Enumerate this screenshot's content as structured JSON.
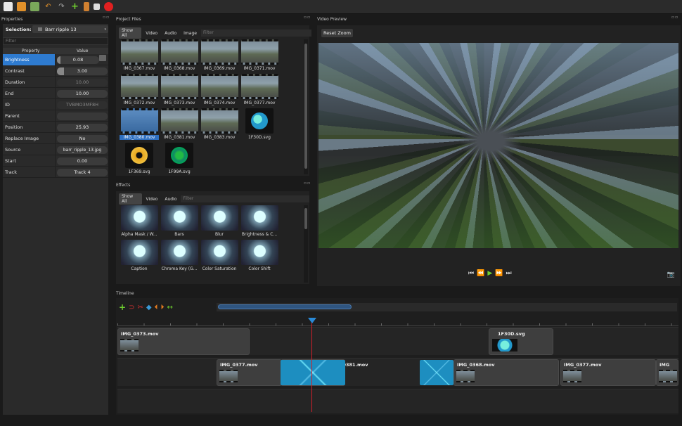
{
  "toolbar": {
    "buttons": [
      "new-project",
      "open-project",
      "save-project",
      "undo",
      "redo",
      "import-files",
      "choose-profile",
      "fullscreen",
      "export"
    ]
  },
  "properties": {
    "title": "Properties",
    "selection_label": "Selection:",
    "selection_value": "Barr ripple 13",
    "filter_placeholder": "Filter",
    "col_property": "Property",
    "col_value": "Value",
    "rows": [
      {
        "name": "Brightness",
        "value": "0.08"
      },
      {
        "name": "Contrast",
        "value": "3.00"
      },
      {
        "name": "Duration",
        "value": "10.00"
      },
      {
        "name": "End",
        "value": "10.00"
      },
      {
        "name": "ID",
        "value": "TVBMO3MF8H"
      },
      {
        "name": "Parent",
        "value": ""
      },
      {
        "name": "Position",
        "value": "25.93"
      },
      {
        "name": "Replace Image",
        "value": "No"
      },
      {
        "name": "Source",
        "value": "barr_ripple_13.jpg"
      },
      {
        "name": "Start",
        "value": "0.00"
      },
      {
        "name": "Track",
        "value": "Track 4"
      }
    ]
  },
  "project_files": {
    "title": "Project Files",
    "filters": [
      "Show All",
      "Video",
      "Audio",
      "Image"
    ],
    "filter_placeholder": "Filter",
    "items": [
      "IMG_0367.mov",
      "IMG_0368.mov",
      "IMG_0369.mov",
      "IMG_0371.mov",
      "IMG_0372.mov",
      "IMG_0373.mov",
      "IMG_0374.mov",
      "IMG_0377.mov",
      "IMG_0380.mov",
      "IMG_0381.mov",
      "IMG_0383.mov",
      "1F30D.svg",
      "1F369.svg",
      "1F99A.svg"
    ]
  },
  "effects": {
    "title": "Effects",
    "filters": [
      "Show All",
      "Video",
      "Audio"
    ],
    "filter_placeholder": "Filter",
    "items": [
      "Alpha Mask / W...",
      "Bars",
      "Blur",
      "Brightness & C...",
      "Caption",
      "Chroma Key (G...",
      "Color Saturation",
      "Color Shift"
    ]
  },
  "video_preview": {
    "title": "Video Preview",
    "reset_zoom": "Reset Zoom"
  },
  "timeline": {
    "title": "Timeline",
    "track1": [
      {
        "name": "IMG_0373.mov"
      },
      {
        "name": "1F30D.svg"
      }
    ],
    "track2": [
      {
        "name": "IMG_0377.mov"
      },
      {
        "name": "IMG_0381.mov"
      },
      {
        "name": "IMG_0368.mov"
      },
      {
        "name": "IMG_0377.mov"
      },
      {
        "name": "IMG"
      }
    ]
  }
}
